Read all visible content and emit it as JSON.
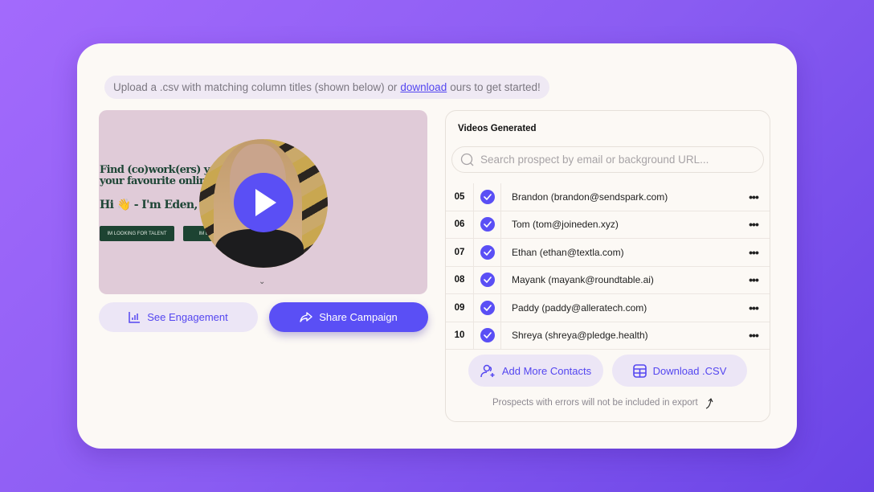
{
  "hint": {
    "prefix": "Upload a .csv with matching column titles (shown below) or",
    "link": "download",
    "suffix": "ours to get started!"
  },
  "video_preview": {
    "headline_line1": "Find (co)work(ers) you",
    "headline_line2": "your favourite online",
    "greeting": "Hi 👋 - I'm Eden, the",
    "button1": "IM LOOKING FOR TALENT",
    "button2": "IM LOO",
    "play_icon": "play-icon",
    "scroll_icon": "chevron-down-icon"
  },
  "actions": {
    "engagement_label": "See Engagement",
    "share_label": "Share Campaign"
  },
  "panel": {
    "title": "Videos Generated",
    "search_placeholder": "Search prospect by email or background URL...",
    "rows": [
      {
        "num": "05",
        "name": "Brandon (brandon@sendspark.com)",
        "checked": true
      },
      {
        "num": "06",
        "name": "Tom (tom@joineden.xyz)",
        "checked": true
      },
      {
        "num": "07",
        "name": "Ethan (ethan@textla.com)",
        "checked": true
      },
      {
        "num": "08",
        "name": "Mayank (mayank@roundtable.ai)",
        "checked": true
      },
      {
        "num": "09",
        "name": "Paddy (paddy@alleratech.com)",
        "checked": true
      },
      {
        "num": "10",
        "name": "Shreya (shreya@pledge.health)",
        "checked": true
      }
    ],
    "add_contacts_label": "Add More Contacts",
    "download_label": "Download .CSV",
    "note": "Prospects with errors will not be included in export"
  },
  "colors": {
    "accent": "#5a4ff5",
    "light_button": "#ece6f6",
    "card": "#fcf9f5",
    "video_bg": "#e0cbd8"
  }
}
